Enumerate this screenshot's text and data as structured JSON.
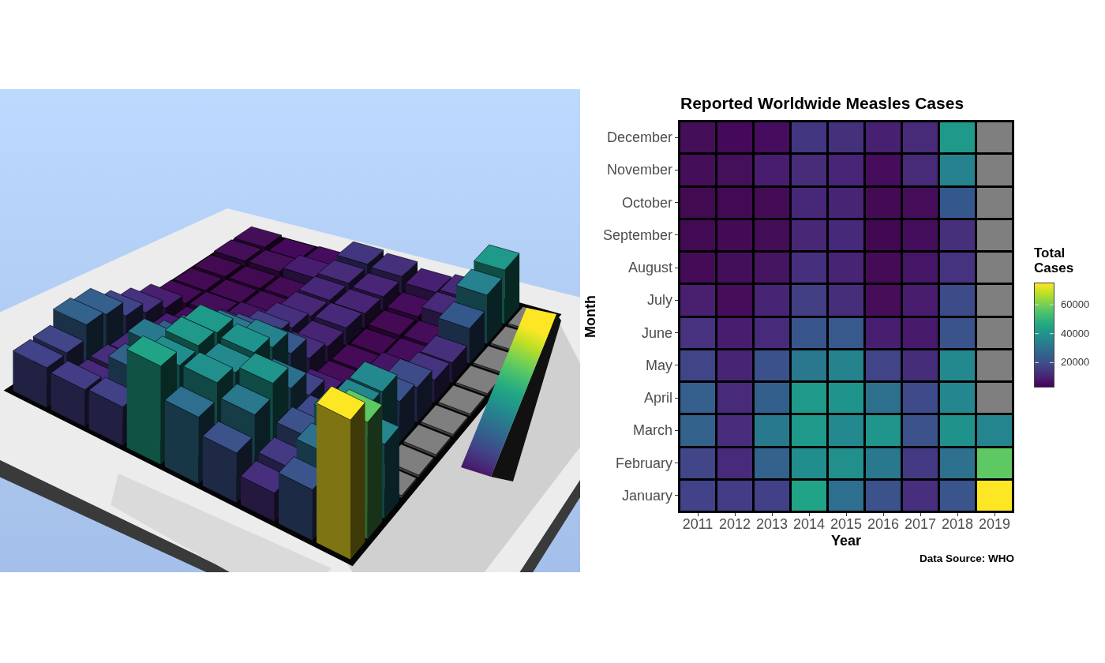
{
  "heatmap": {
    "title": "Reported Worldwide Measles Cases",
    "y_title": "Month",
    "rows": [
      {
        "month": "December",
        "cells": [
          {
            "color": "#440f58"
          },
          {
            "color": "#45095b"
          },
          {
            "color": "#460d5e"
          },
          {
            "color": "#433680"
          },
          {
            "color": "#45307c"
          },
          {
            "color": "#482071"
          },
          {
            "color": "#472a78"
          },
          {
            "color": "#1f9a8a"
          },
          {
            "color": "#7f7f7f"
          }
        ]
      },
      {
        "month": "November",
        "cells": [
          {
            "color": "#440f58"
          },
          {
            "color": "#44105a"
          },
          {
            "color": "#481d6f"
          },
          {
            "color": "#472c7a"
          },
          {
            "color": "#482576"
          },
          {
            "color": "#450d5c"
          },
          {
            "color": "#472a78"
          },
          {
            "color": "#26828e"
          },
          {
            "color": "#7f7f7f"
          }
        ]
      },
      {
        "month": "October",
        "cells": [
          {
            "color": "#420a50"
          },
          {
            "color": "#420a52"
          },
          {
            "color": "#430c55"
          },
          {
            "color": "#472878"
          },
          {
            "color": "#482475"
          },
          {
            "color": "#440b54"
          },
          {
            "color": "#450d5a"
          },
          {
            "color": "#35588c"
          },
          {
            "color": "#7f7f7f"
          }
        ]
      },
      {
        "month": "September",
        "cells": [
          {
            "color": "#420a52"
          },
          {
            "color": "#440b55"
          },
          {
            "color": "#440d58"
          },
          {
            "color": "#482776"
          },
          {
            "color": "#47297a"
          },
          {
            "color": "#430852"
          },
          {
            "color": "#450e5c"
          },
          {
            "color": "#46307c"
          },
          {
            "color": "#7f7f7f"
          }
        ]
      },
      {
        "month": "August",
        "cells": [
          {
            "color": "#440c56"
          },
          {
            "color": "#440f5a"
          },
          {
            "color": "#451561"
          },
          {
            "color": "#46307e"
          },
          {
            "color": "#482475"
          },
          {
            "color": "#450b57"
          },
          {
            "color": "#461666"
          },
          {
            "color": "#46337f"
          },
          {
            "color": "#7f7f7f"
          }
        ]
      },
      {
        "month": "July",
        "cells": [
          {
            "color": "#48206f"
          },
          {
            "color": "#450d5a"
          },
          {
            "color": "#482475"
          },
          {
            "color": "#423f85"
          },
          {
            "color": "#472e7b"
          },
          {
            "color": "#460d59"
          },
          {
            "color": "#471c6c"
          },
          {
            "color": "#3d4b89"
          },
          {
            "color": "#7f7f7f"
          }
        ]
      },
      {
        "month": "June",
        "cells": [
          {
            "color": "#46327e"
          },
          {
            "color": "#481c6e"
          },
          {
            "color": "#472a7a"
          },
          {
            "color": "#39568c"
          },
          {
            "color": "#37598c"
          },
          {
            "color": "#481f70"
          },
          {
            "color": "#481a6c"
          },
          {
            "color": "#3a538b"
          },
          {
            "color": "#7f7f7f"
          }
        ]
      },
      {
        "month": "May",
        "cells": [
          {
            "color": "#404588"
          },
          {
            "color": "#482475"
          },
          {
            "color": "#3b518b"
          },
          {
            "color": "#2a788e"
          },
          {
            "color": "#25838e"
          },
          {
            "color": "#414487"
          },
          {
            "color": "#462d7a"
          },
          {
            "color": "#23898e"
          },
          {
            "color": "#7f7f7f"
          }
        ]
      },
      {
        "month": "April",
        "cells": [
          {
            "color": "#355f8d"
          },
          {
            "color": "#472a7a"
          },
          {
            "color": "#335f8d"
          },
          {
            "color": "#1f9a8a"
          },
          {
            "color": "#1f948c"
          },
          {
            "color": "#2d708e"
          },
          {
            "color": "#3e4a89"
          },
          {
            "color": "#24868e"
          },
          {
            "color": "#7f7f7f"
          }
        ]
      },
      {
        "month": "March",
        "cells": [
          {
            "color": "#33628d"
          },
          {
            "color": "#472d7b"
          },
          {
            "color": "#29798e"
          },
          {
            "color": "#1f9a8a"
          },
          {
            "color": "#23898e"
          },
          {
            "color": "#1f958b"
          },
          {
            "color": "#3b528b"
          },
          {
            "color": "#20928c"
          },
          {
            "color": "#25858e"
          }
        ]
      },
      {
        "month": "February",
        "cells": [
          {
            "color": "#404688"
          },
          {
            "color": "#472a7a"
          },
          {
            "color": "#33638d"
          },
          {
            "color": "#218e8d"
          },
          {
            "color": "#21908c"
          },
          {
            "color": "#2a788e"
          },
          {
            "color": "#443a83"
          },
          {
            "color": "#2d718e"
          },
          {
            "color": "#5ec962"
          }
        ]
      },
      {
        "month": "January",
        "cells": [
          {
            "color": "#414287"
          },
          {
            "color": "#423d84"
          },
          {
            "color": "#424086"
          },
          {
            "color": "#20a386"
          },
          {
            "color": "#2e6e8e"
          },
          {
            "color": "#3b528b"
          },
          {
            "color": "#472f7d"
          },
          {
            "color": "#3a548c"
          },
          {
            "color": "#fde725"
          }
        ]
      }
    ],
    "years": [
      "2011",
      "2012",
      "2013",
      "2014",
      "2015",
      "2016",
      "2017",
      "2018",
      "2019"
    ],
    "x_title": "Year",
    "caption": "Data Source: WHO"
  },
  "legend": {
    "title": "Total\nCases",
    "ticks": [
      "60000",
      "40000",
      "20000"
    ]
  }
}
